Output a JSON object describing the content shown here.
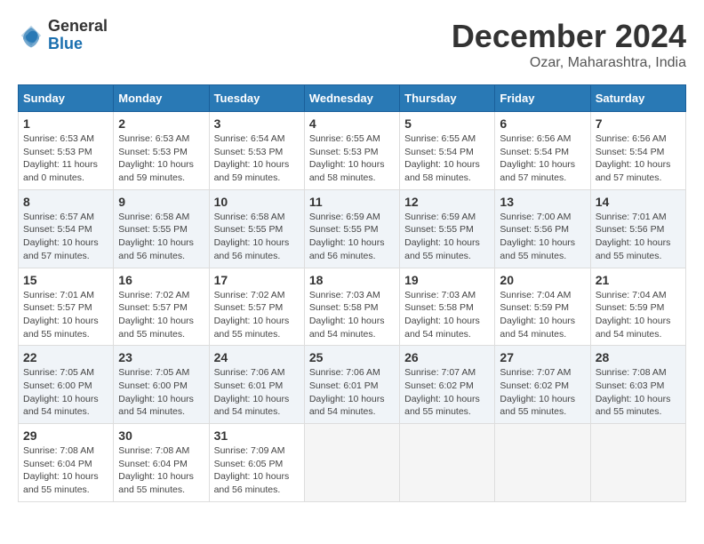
{
  "logo": {
    "general": "General",
    "blue": "Blue"
  },
  "title": {
    "month_year": "December 2024",
    "location": "Ozar, Maharashtra, India"
  },
  "calendar": {
    "headers": [
      "Sunday",
      "Monday",
      "Tuesday",
      "Wednesday",
      "Thursday",
      "Friday",
      "Saturday"
    ],
    "weeks": [
      [
        {
          "day": "1",
          "info": "Sunrise: 6:53 AM\nSunset: 5:53 PM\nDaylight: 11 hours\nand 0 minutes."
        },
        {
          "day": "2",
          "info": "Sunrise: 6:53 AM\nSunset: 5:53 PM\nDaylight: 10 hours\nand 59 minutes."
        },
        {
          "day": "3",
          "info": "Sunrise: 6:54 AM\nSunset: 5:53 PM\nDaylight: 10 hours\nand 59 minutes."
        },
        {
          "day": "4",
          "info": "Sunrise: 6:55 AM\nSunset: 5:53 PM\nDaylight: 10 hours\nand 58 minutes."
        },
        {
          "day": "5",
          "info": "Sunrise: 6:55 AM\nSunset: 5:54 PM\nDaylight: 10 hours\nand 58 minutes."
        },
        {
          "day": "6",
          "info": "Sunrise: 6:56 AM\nSunset: 5:54 PM\nDaylight: 10 hours\nand 57 minutes."
        },
        {
          "day": "7",
          "info": "Sunrise: 6:56 AM\nSunset: 5:54 PM\nDaylight: 10 hours\nand 57 minutes."
        }
      ],
      [
        {
          "day": "8",
          "info": "Sunrise: 6:57 AM\nSunset: 5:54 PM\nDaylight: 10 hours\nand 57 minutes."
        },
        {
          "day": "9",
          "info": "Sunrise: 6:58 AM\nSunset: 5:55 PM\nDaylight: 10 hours\nand 56 minutes."
        },
        {
          "day": "10",
          "info": "Sunrise: 6:58 AM\nSunset: 5:55 PM\nDaylight: 10 hours\nand 56 minutes."
        },
        {
          "day": "11",
          "info": "Sunrise: 6:59 AM\nSunset: 5:55 PM\nDaylight: 10 hours\nand 56 minutes."
        },
        {
          "day": "12",
          "info": "Sunrise: 6:59 AM\nSunset: 5:55 PM\nDaylight: 10 hours\nand 55 minutes."
        },
        {
          "day": "13",
          "info": "Sunrise: 7:00 AM\nSunset: 5:56 PM\nDaylight: 10 hours\nand 55 minutes."
        },
        {
          "day": "14",
          "info": "Sunrise: 7:01 AM\nSunset: 5:56 PM\nDaylight: 10 hours\nand 55 minutes."
        }
      ],
      [
        {
          "day": "15",
          "info": "Sunrise: 7:01 AM\nSunset: 5:57 PM\nDaylight: 10 hours\nand 55 minutes."
        },
        {
          "day": "16",
          "info": "Sunrise: 7:02 AM\nSunset: 5:57 PM\nDaylight: 10 hours\nand 55 minutes."
        },
        {
          "day": "17",
          "info": "Sunrise: 7:02 AM\nSunset: 5:57 PM\nDaylight: 10 hours\nand 55 minutes."
        },
        {
          "day": "18",
          "info": "Sunrise: 7:03 AM\nSunset: 5:58 PM\nDaylight: 10 hours\nand 54 minutes."
        },
        {
          "day": "19",
          "info": "Sunrise: 7:03 AM\nSunset: 5:58 PM\nDaylight: 10 hours\nand 54 minutes."
        },
        {
          "day": "20",
          "info": "Sunrise: 7:04 AM\nSunset: 5:59 PM\nDaylight: 10 hours\nand 54 minutes."
        },
        {
          "day": "21",
          "info": "Sunrise: 7:04 AM\nSunset: 5:59 PM\nDaylight: 10 hours\nand 54 minutes."
        }
      ],
      [
        {
          "day": "22",
          "info": "Sunrise: 7:05 AM\nSunset: 6:00 PM\nDaylight: 10 hours\nand 54 minutes."
        },
        {
          "day": "23",
          "info": "Sunrise: 7:05 AM\nSunset: 6:00 PM\nDaylight: 10 hours\nand 54 minutes."
        },
        {
          "day": "24",
          "info": "Sunrise: 7:06 AM\nSunset: 6:01 PM\nDaylight: 10 hours\nand 54 minutes."
        },
        {
          "day": "25",
          "info": "Sunrise: 7:06 AM\nSunset: 6:01 PM\nDaylight: 10 hours\nand 54 minutes."
        },
        {
          "day": "26",
          "info": "Sunrise: 7:07 AM\nSunset: 6:02 PM\nDaylight: 10 hours\nand 55 minutes."
        },
        {
          "day": "27",
          "info": "Sunrise: 7:07 AM\nSunset: 6:02 PM\nDaylight: 10 hours\nand 55 minutes."
        },
        {
          "day": "28",
          "info": "Sunrise: 7:08 AM\nSunset: 6:03 PM\nDaylight: 10 hours\nand 55 minutes."
        }
      ],
      [
        {
          "day": "29",
          "info": "Sunrise: 7:08 AM\nSunset: 6:04 PM\nDaylight: 10 hours\nand 55 minutes."
        },
        {
          "day": "30",
          "info": "Sunrise: 7:08 AM\nSunset: 6:04 PM\nDaylight: 10 hours\nand 55 minutes."
        },
        {
          "day": "31",
          "info": "Sunrise: 7:09 AM\nSunset: 6:05 PM\nDaylight: 10 hours\nand 56 minutes."
        },
        {
          "day": "",
          "info": ""
        },
        {
          "day": "",
          "info": ""
        },
        {
          "day": "",
          "info": ""
        },
        {
          "day": "",
          "info": ""
        }
      ]
    ]
  }
}
